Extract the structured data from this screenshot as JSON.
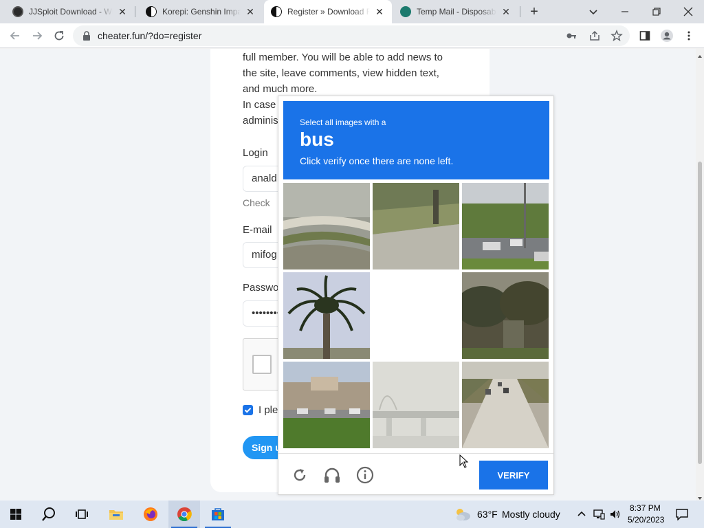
{
  "browser": {
    "tabs": [
      {
        "title": "JJSploit Download - Wi",
        "active": false
      },
      {
        "title": "Korepi: Genshin Impact",
        "active": false
      },
      {
        "title": "Register » Download Fr",
        "active": true
      },
      {
        "title": "Temp Mail - Disposable",
        "active": false
      }
    ],
    "url": "cheater.fun/?do=register"
  },
  "page": {
    "intro_lines": [
      "full member. You will be able to add news to",
      "the site, leave comments, view hidden text,",
      "and much more.",
      "In case",
      "adminis"
    ],
    "login_label": "Login",
    "login_value": "anald",
    "check_link": "Check",
    "email_label": "E-mail",
    "email_value": "mifog",
    "password_label": "Passwo",
    "password_value": "••••••••",
    "agree_text": "I ple",
    "signup_label": "Sign u"
  },
  "captcha": {
    "select_text": "Select all images with a",
    "target_word": "bus",
    "instruction": "Click verify once there are none left.",
    "verify_label": "VERIFY",
    "header_color": "#1a73e8"
  },
  "taskbar": {
    "weather_temp": "63°F",
    "weather_desc": "Mostly cloudy",
    "time": "8:37 PM",
    "date": "5/20/2023"
  }
}
